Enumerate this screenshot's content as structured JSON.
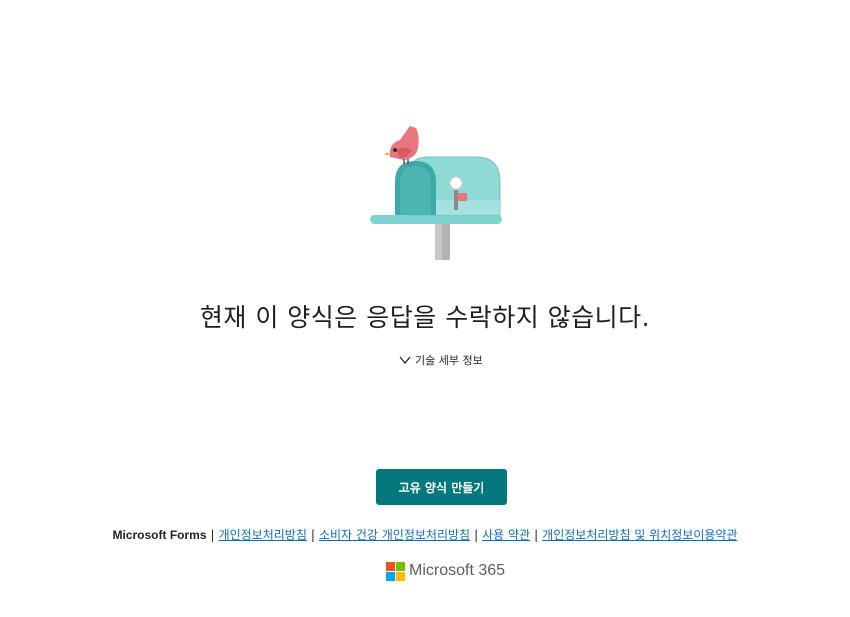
{
  "message": {
    "title": "현재 이 양식은 응답을 수락하지 않습니다.",
    "details_toggle_label": "기술 세부 정보"
  },
  "actions": {
    "create_form_label": "고유 양식 만들기"
  },
  "footer": {
    "brand": "Microsoft Forms",
    "separator": "|",
    "links": [
      "개인정보처리방침",
      "소비자 건강 개인정보처리방침",
      "사용 약관",
      "개인정보처리방침 및 위치정보이용약관"
    ],
    "product_name": "Microsoft 365"
  },
  "icons": {
    "illustration": "mailbox-bird-illustration",
    "toggle": "chevron-down-icon",
    "logo": "microsoft-logo-icon"
  },
  "colors": {
    "primary_button": "#03787c",
    "link": "#0f6cbd",
    "mailbox": "#7fd3d1",
    "bird": "#e8767e",
    "logo_red": "#f25022",
    "logo_green": "#7fba00",
    "logo_blue": "#00a4ef",
    "logo_yellow": "#ffb900"
  }
}
